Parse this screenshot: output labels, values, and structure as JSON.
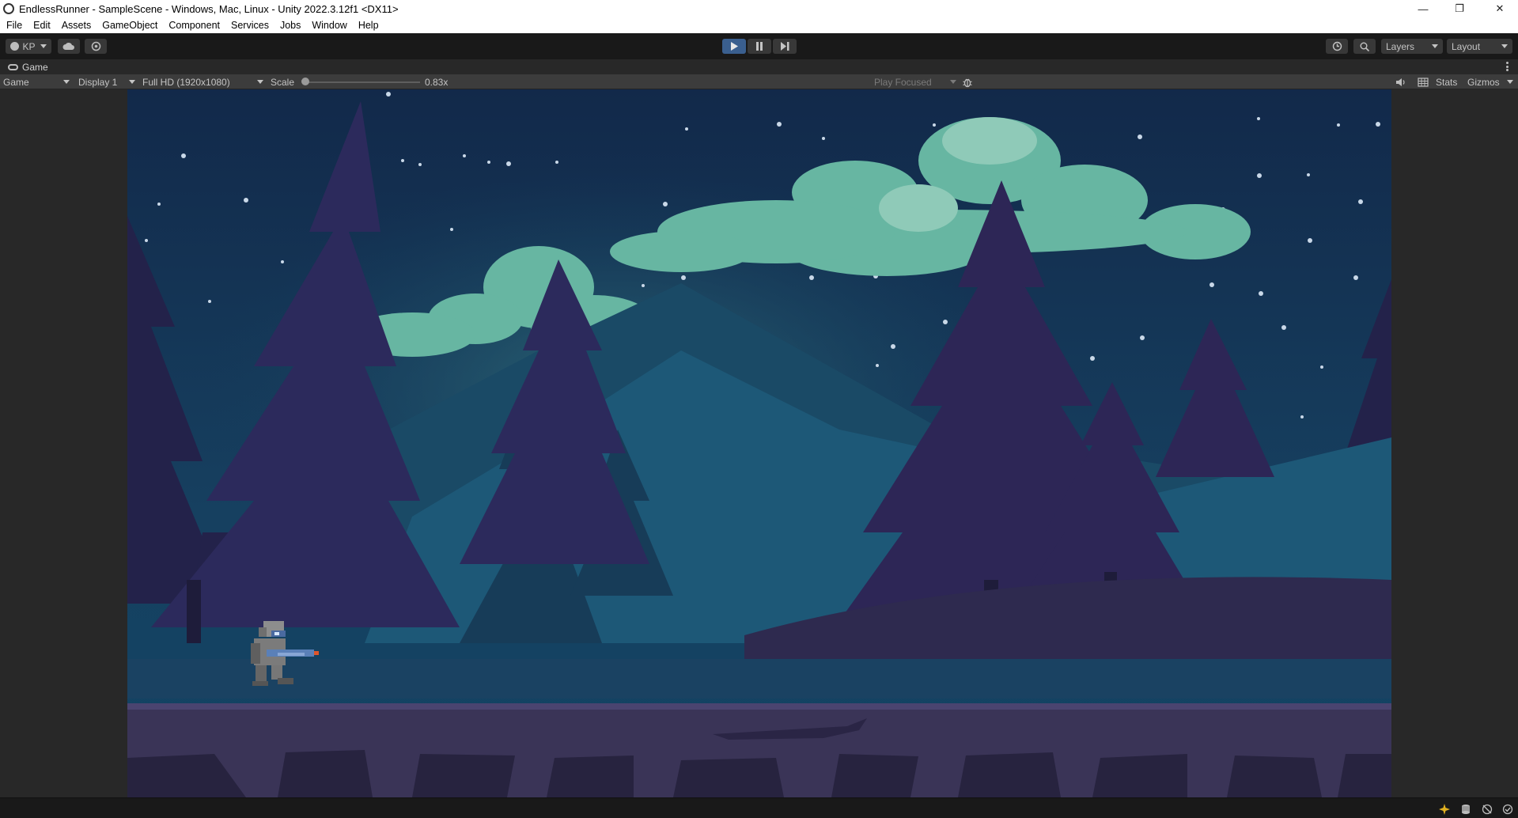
{
  "window": {
    "title": "EndlessRunner - SampleScene - Windows, Mac, Linux - Unity 2022.3.12f1 <DX11>",
    "minimize_glyph": "—",
    "maximize_glyph": "❐",
    "close_glyph": "✕"
  },
  "menubar": {
    "items": [
      "File",
      "Edit",
      "Assets",
      "GameObject",
      "Component",
      "Services",
      "Jobs",
      "Window",
      "Help"
    ]
  },
  "toolbar": {
    "account_label": "KP",
    "layers_label": "Layers",
    "layout_label": "Layout",
    "play_state": "playing"
  },
  "tab": {
    "label": "Game"
  },
  "gamebar": {
    "view_mode": "Game",
    "display": "Display 1",
    "resolution": "Full HD (1920x1080)",
    "scale_label": "Scale",
    "scale_value": "0.83x",
    "scale_fraction": 0.0,
    "play_mode": "Play Focused",
    "stats_label": "Stats",
    "gizmos_label": "Gizmos"
  },
  "colors": {
    "editor_bg": "#282828",
    "toolbar_bg": "#191919",
    "play_active": "#3a5f8f",
    "sky": "#15304a",
    "cloud": "#6fb8a6",
    "ground": "#3b3558"
  }
}
